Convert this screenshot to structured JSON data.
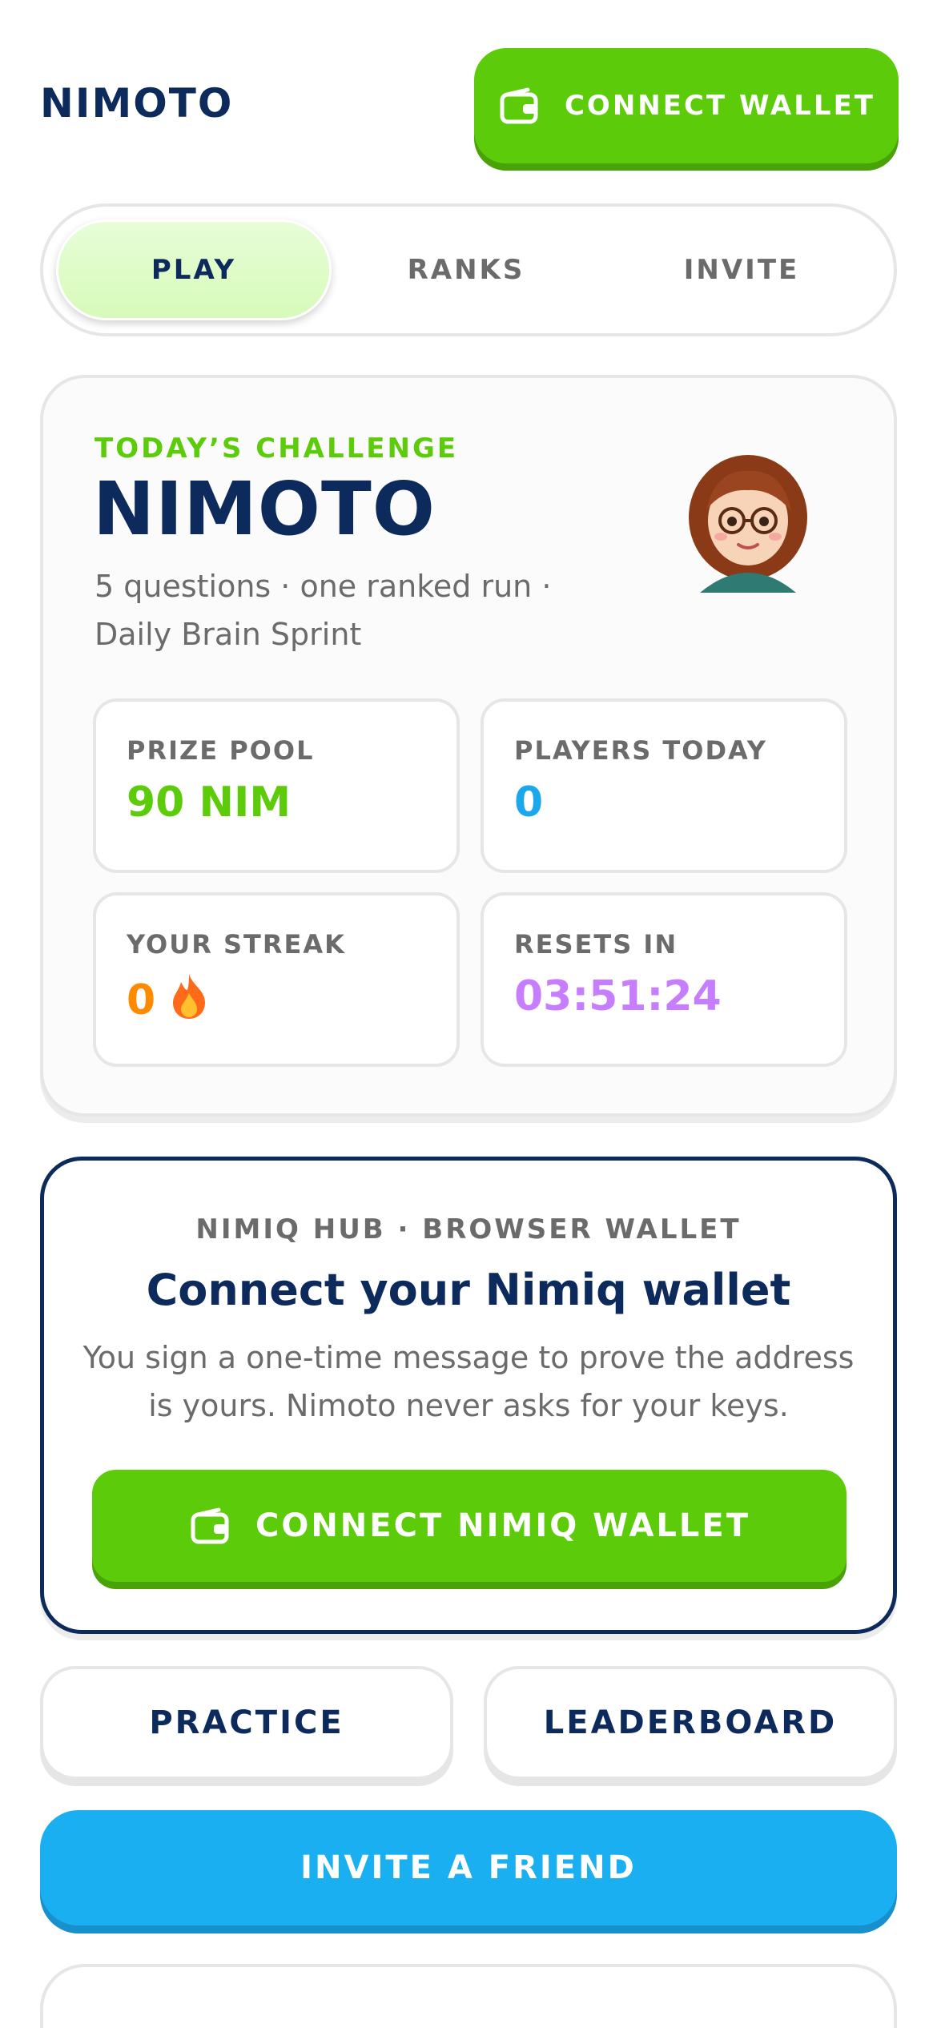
{
  "header": {
    "brand": "NIMOTO",
    "connect_wallet_label": "CONNECT WALLET",
    "wallet_icon": "wallet-icon"
  },
  "tabs": [
    {
      "label": "PLAY",
      "active": true
    },
    {
      "label": "RANKS",
      "active": false
    },
    {
      "label": "INVITE",
      "active": false
    }
  ],
  "challenge": {
    "eyebrow": "TODAY’S CHALLENGE",
    "title": "NIMOTO",
    "subtitle": "5 questions · one ranked run · Daily Brain Sprint",
    "avatar": "cartoon-girl-avatar",
    "stats": {
      "prize_pool": {
        "label": "PRIZE POOL",
        "value": "90 NIM"
      },
      "players_today": {
        "label": "PLAYERS TODAY",
        "value": "0"
      },
      "streak": {
        "label": "YOUR STREAK",
        "value": "0",
        "icon": "flame-icon"
      },
      "resets_in": {
        "label": "RESETS IN",
        "value": "03:51:24"
      }
    }
  },
  "connect": {
    "kicker": "NIMIQ HUB · BROWSER WALLET",
    "title": "Connect your Nimiq wallet",
    "description": "You sign a one-time message to prove the address is yours. Nimoto never asks for your keys.",
    "button_label": "CONNECT NIMIQ WALLET"
  },
  "actions": {
    "practice": "PRACTICE",
    "leaderboard": "LEADERBOARD",
    "invite": "INVITE A FRIEND"
  },
  "colors": {
    "navy": "#0d2a5c",
    "green": "#5ccc0a",
    "blue": "#1aa7ec",
    "orange": "#ff8a00",
    "purple": "#c77dff",
    "gray_text": "#6b6b6b"
  }
}
